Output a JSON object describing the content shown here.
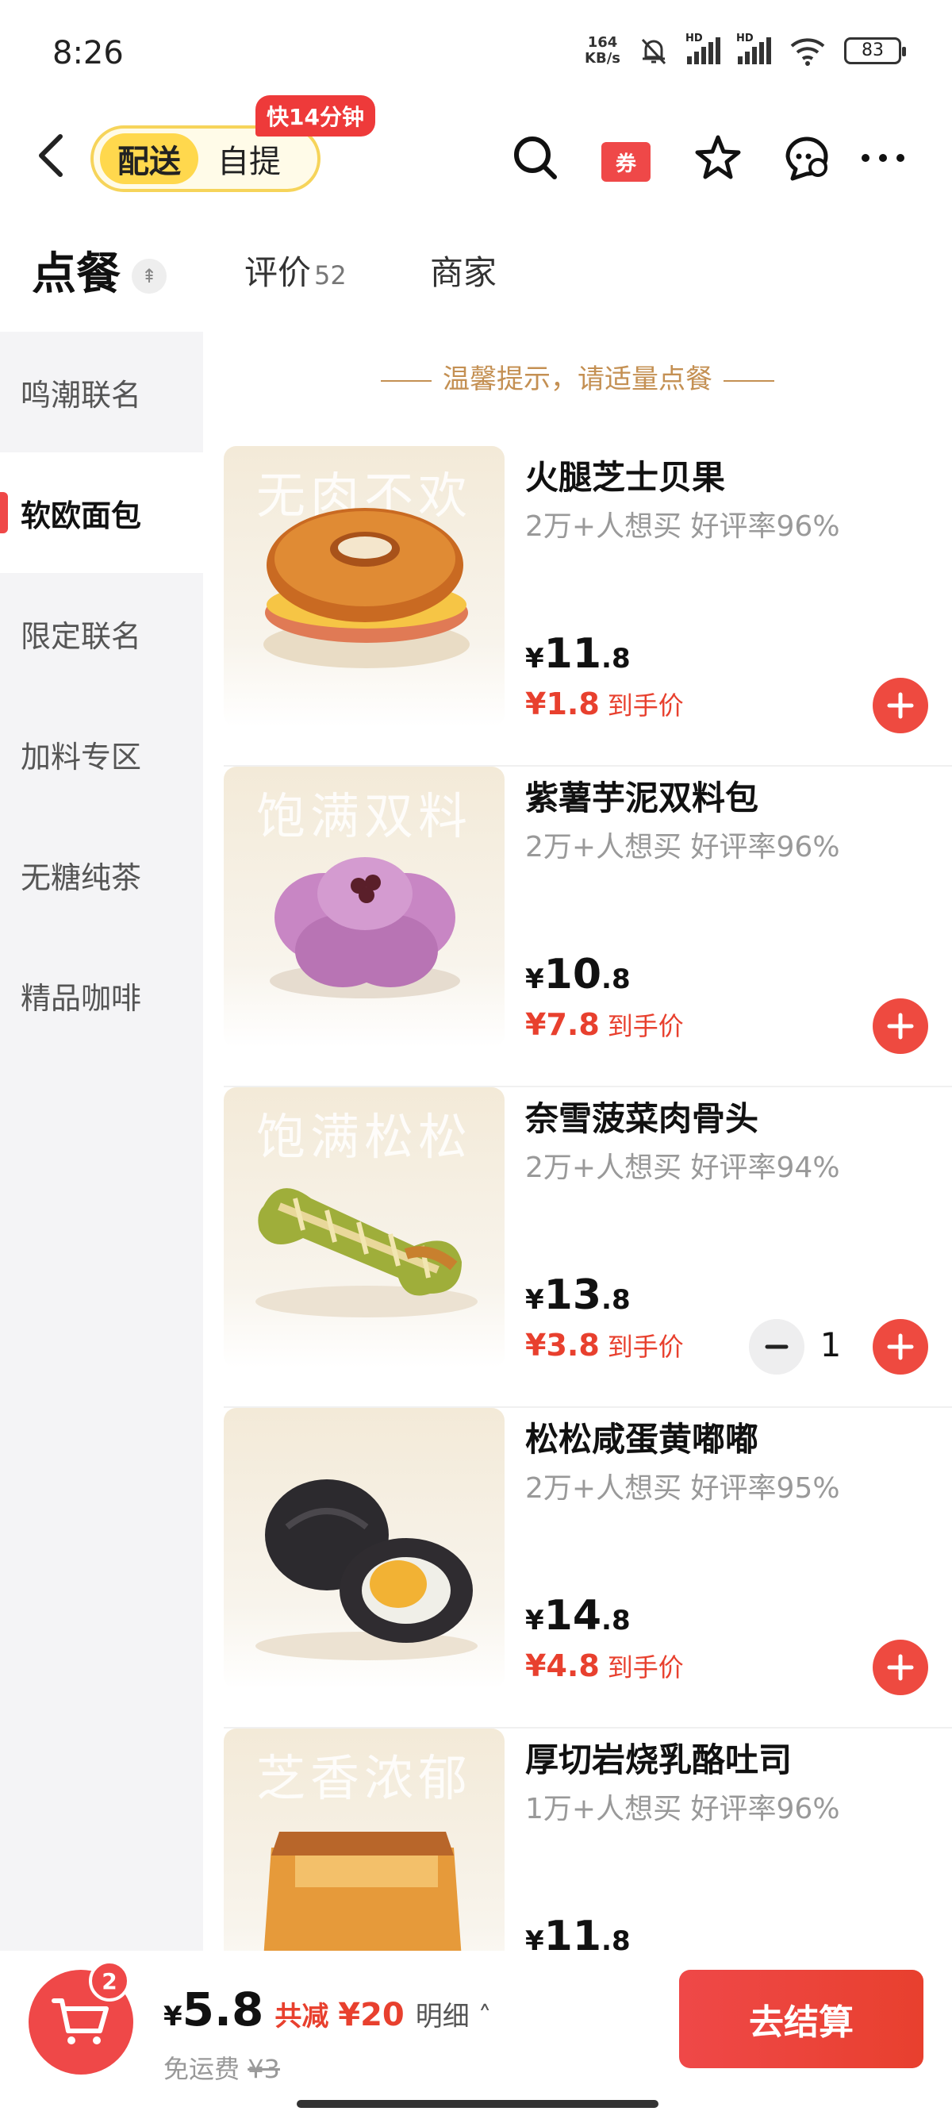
{
  "status_bar": {
    "time": "8:26",
    "net_speed_value": "164",
    "net_speed_unit": "KB/s",
    "battery": "83",
    "sig1_label": "HD",
    "sig2_label": "HD"
  },
  "header": {
    "mode_active": "配送",
    "mode_other": "自提",
    "fast_badge": "快14分钟",
    "coupon_label": "券"
  },
  "tabs": [
    {
      "label": "点餐"
    },
    {
      "label": "评价",
      "count": "52"
    },
    {
      "label": "商家"
    }
  ],
  "sidebar": {
    "items": [
      {
        "label": "鸣潮联名"
      },
      {
        "label": "软欧面包",
        "active": true
      },
      {
        "label": "限定联名"
      },
      {
        "label": "加料专区"
      },
      {
        "label": "无糖纯茶"
      },
      {
        "label": "精品咖啡"
      }
    ]
  },
  "tip": "温馨提示，请适量点餐",
  "products": [
    {
      "slogan": "无肉不欢",
      "name": "火腿芝士贝果",
      "stats": "2万+人想买  好评率96%",
      "price_sym": "¥",
      "price_int": "11",
      "price_dec": ".8",
      "final_price": "¥1.8",
      "final_label": "到手价"
    },
    {
      "slogan": "饱满双料",
      "name": "紫薯芋泥双料包",
      "stats": "2万+人想买  好评率96%",
      "price_sym": "¥",
      "price_int": "10",
      "price_dec": ".8",
      "final_price": "¥7.8",
      "final_label": "到手价"
    },
    {
      "slogan": "饱满松松",
      "name": "奈雪菠菜肉骨头",
      "stats": "2万+人想买  好评率94%",
      "price_sym": "¥",
      "price_int": "13",
      "price_dec": ".8",
      "final_price": "¥3.8",
      "final_label": "到手价",
      "quantity": "1"
    },
    {
      "slogan": "",
      "name": "松松咸蛋黄嘟嘟",
      "stats": "2万+人想买  好评率95%",
      "price_sym": "¥",
      "price_int": "14",
      "price_dec": ".8",
      "final_price": "¥4.8",
      "final_label": "到手价"
    },
    {
      "slogan": "芝香浓郁",
      "name": "厚切岩烧乳酪吐司",
      "stats": "1万+人想买  好评率96%",
      "price_sym": "¥",
      "price_int": "11",
      "price_dec": ".8"
    }
  ],
  "cart": {
    "count": "2",
    "total_symbol": "¥",
    "total_value": "5.8",
    "discount_label": "共减",
    "discount_value": "¥20",
    "detail_label": "明细",
    "delivery_label": "免运费",
    "delivery_original": "¥3",
    "checkout_label": "去结算"
  },
  "colors": {
    "accent": "#ef4848",
    "mode_yellow": "#ffd84d",
    "tip": "#c49053",
    "final_price": "#e8402e"
  }
}
